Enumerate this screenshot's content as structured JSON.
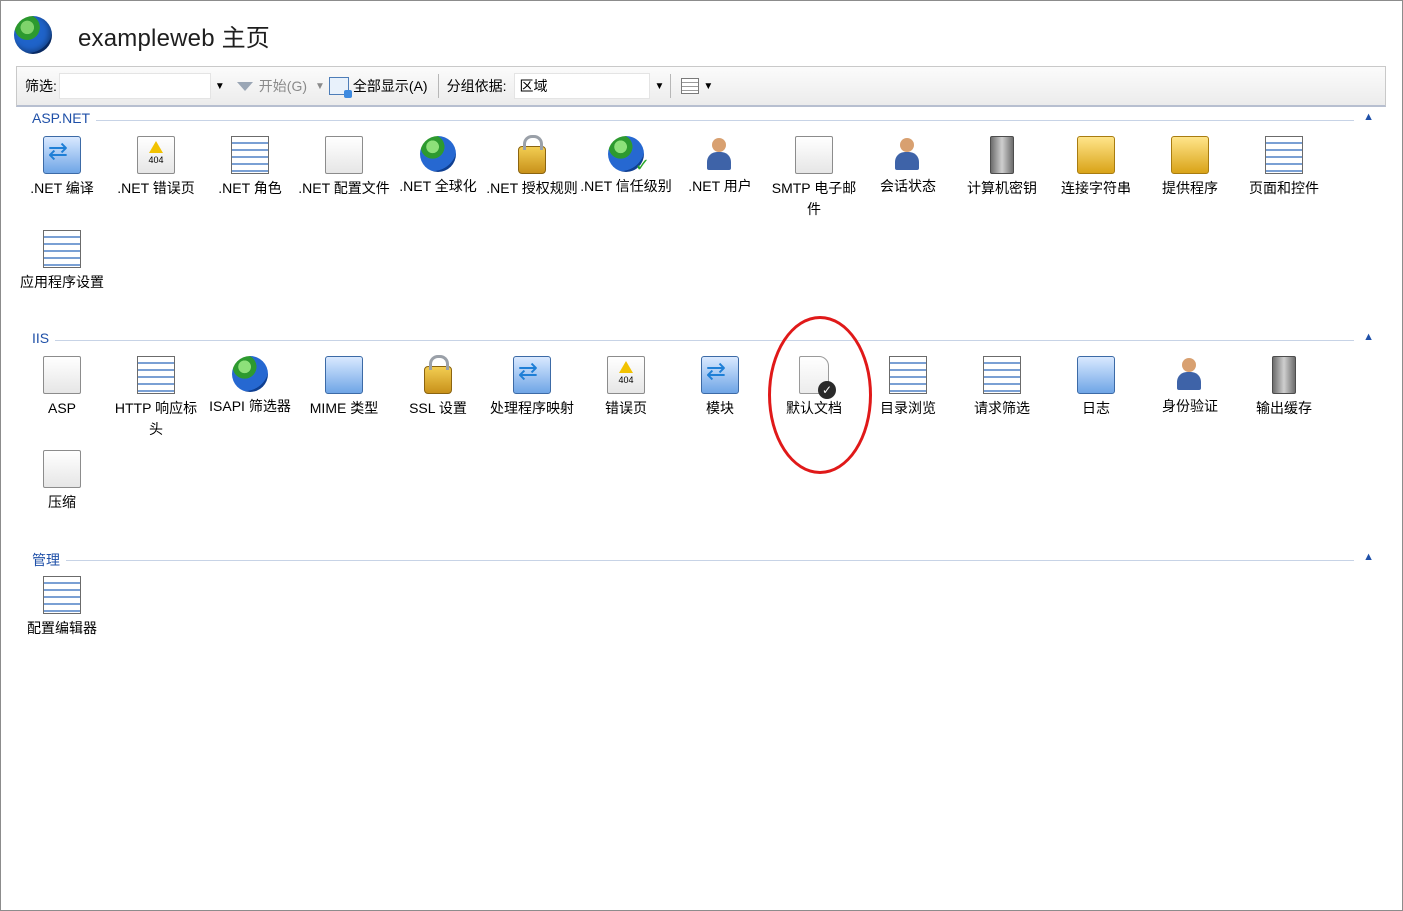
{
  "header": {
    "title": "exampleweb 主页",
    "icon": "iis-globe-icon"
  },
  "toolbar": {
    "filter_label": "筛选:",
    "filter_value": "",
    "start_label": "开始(G)",
    "show_all_label": "全部显示(A)",
    "group_by_label": "分组依据:",
    "group_by_value": "区域",
    "view_icon": "view-toggle-icon"
  },
  "sections": {
    "aspnet": {
      "title": "ASP.NET",
      "items": [
        {
          "label": ".NET 编译",
          "icon": "dotnet-compilation-icon"
        },
        {
          "label": ".NET 错误页",
          "icon": "dotnet-error-pages-icon"
        },
        {
          "label": ".NET 角色",
          "icon": "dotnet-roles-icon"
        },
        {
          "label": ".NET 配置文件",
          "icon": "dotnet-profile-icon"
        },
        {
          "label": ".NET 全球化",
          "icon": "dotnet-globalization-icon"
        },
        {
          "label": ".NET 授权规则",
          "icon": "dotnet-authorization-rules-icon"
        },
        {
          "label": ".NET 信任级别",
          "icon": "dotnet-trust-levels-icon"
        },
        {
          "label": ".NET 用户",
          "icon": "dotnet-users-icon"
        },
        {
          "label": "SMTP 电子邮件",
          "icon": "smtp-email-icon"
        },
        {
          "label": "会话状态",
          "icon": "session-state-icon"
        },
        {
          "label": "计算机密钥",
          "icon": "machine-key-icon"
        },
        {
          "label": "连接字符串",
          "icon": "connection-strings-icon"
        },
        {
          "label": "提供程序",
          "icon": "providers-icon"
        },
        {
          "label": "页面和控件",
          "icon": "pages-controls-icon"
        },
        {
          "label": "应用程序设置",
          "icon": "app-settings-icon"
        }
      ]
    },
    "iis": {
      "title": "IIS",
      "items": [
        {
          "label": "ASP",
          "icon": "asp-icon"
        },
        {
          "label": "HTTP 响应标头",
          "icon": "http-response-headers-icon"
        },
        {
          "label": "ISAPI 筛选器",
          "icon": "isapi-filters-icon"
        },
        {
          "label": "MIME 类型",
          "icon": "mime-types-icon"
        },
        {
          "label": "SSL 设置",
          "icon": "ssl-settings-icon"
        },
        {
          "label": "处理程序映射",
          "icon": "handler-mappings-icon"
        },
        {
          "label": "错误页",
          "icon": "error-pages-icon"
        },
        {
          "label": "模块",
          "icon": "modules-icon"
        },
        {
          "label": "默认文档",
          "icon": "default-document-icon"
        },
        {
          "label": "目录浏览",
          "icon": "directory-browsing-icon"
        },
        {
          "label": "请求筛选",
          "icon": "request-filtering-icon"
        },
        {
          "label": "日志",
          "icon": "logging-icon"
        },
        {
          "label": "身份验证",
          "icon": "authentication-icon"
        },
        {
          "label": "输出缓存",
          "icon": "output-caching-icon"
        },
        {
          "label": "压缩",
          "icon": "compression-icon"
        }
      ]
    },
    "management": {
      "title": "管理",
      "items": [
        {
          "label": "配置编辑器",
          "icon": "configuration-editor-icon"
        }
      ]
    }
  },
  "annotation": {
    "highlight_color": "#e01919",
    "highlighted_item": "默认文档"
  }
}
